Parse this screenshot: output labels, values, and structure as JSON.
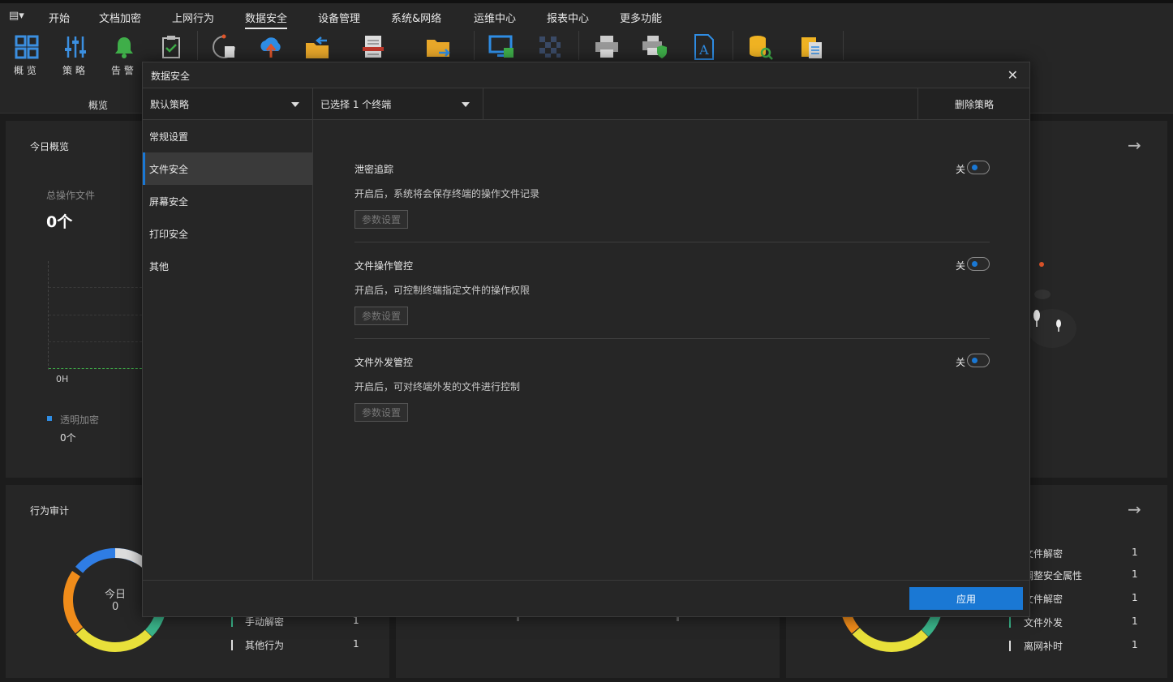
{
  "menu": {
    "items": [
      "开始",
      "文档加密",
      "上网行为",
      "数据安全",
      "设备管理",
      "系统&网络",
      "运维中心",
      "报表中心",
      "更多功能"
    ]
  },
  "toolbar": {
    "overview_label": "概 览",
    "policy_label": "策 略",
    "alarm_label": "告 警",
    "group_label": "概览"
  },
  "dashboard": {
    "today_title": "今日概览",
    "total_files_label": "总操作文件",
    "total_files_value": "0个",
    "axis_label": "0H",
    "legend_name": "透明加密",
    "legend_value": "0个",
    "audit_title": "行为审计",
    "donut_label": "今日",
    "donut_value": "0",
    "left_list": [
      {
        "name": "手动解密",
        "count": "1"
      },
      {
        "name": "其他行为",
        "count": "1"
      }
    ],
    "right_list": [
      {
        "name": "文件解密",
        "count": "1"
      },
      {
        "name": "调整安全属性",
        "count": "1"
      },
      {
        "name": "文件解密",
        "count": "1"
      },
      {
        "name": "文件外发",
        "count": "1"
      },
      {
        "name": "离网补时",
        "count": "1"
      }
    ]
  },
  "dialog": {
    "title": "数据安全",
    "policy_select": "默认策略",
    "terminal_select": "已选择 1 个终端",
    "delete_policy": "删除策略",
    "side_items": [
      "常规设置",
      "文件安全",
      "屏幕安全",
      "打印安全",
      "其他"
    ],
    "settings": [
      {
        "title": "泄密追踪",
        "desc": "开启后，系统将会保存终端的操作文件记录",
        "button": "参数设置",
        "state": "关"
      },
      {
        "title": "文件操作管控",
        "desc": "开启后，可控制终端指定文件的操作权限",
        "button": "参数设置",
        "state": "关"
      },
      {
        "title": "文件外发管控",
        "desc": "开启后，可对终端外发的文件进行控制",
        "button": "参数设置",
        "state": "关"
      }
    ],
    "apply": "应用"
  },
  "colors": {
    "accent": "#1a78d4",
    "toggle_knob": "#1a78d4",
    "background": "#1c1c1c",
    "panel": "#262626"
  }
}
